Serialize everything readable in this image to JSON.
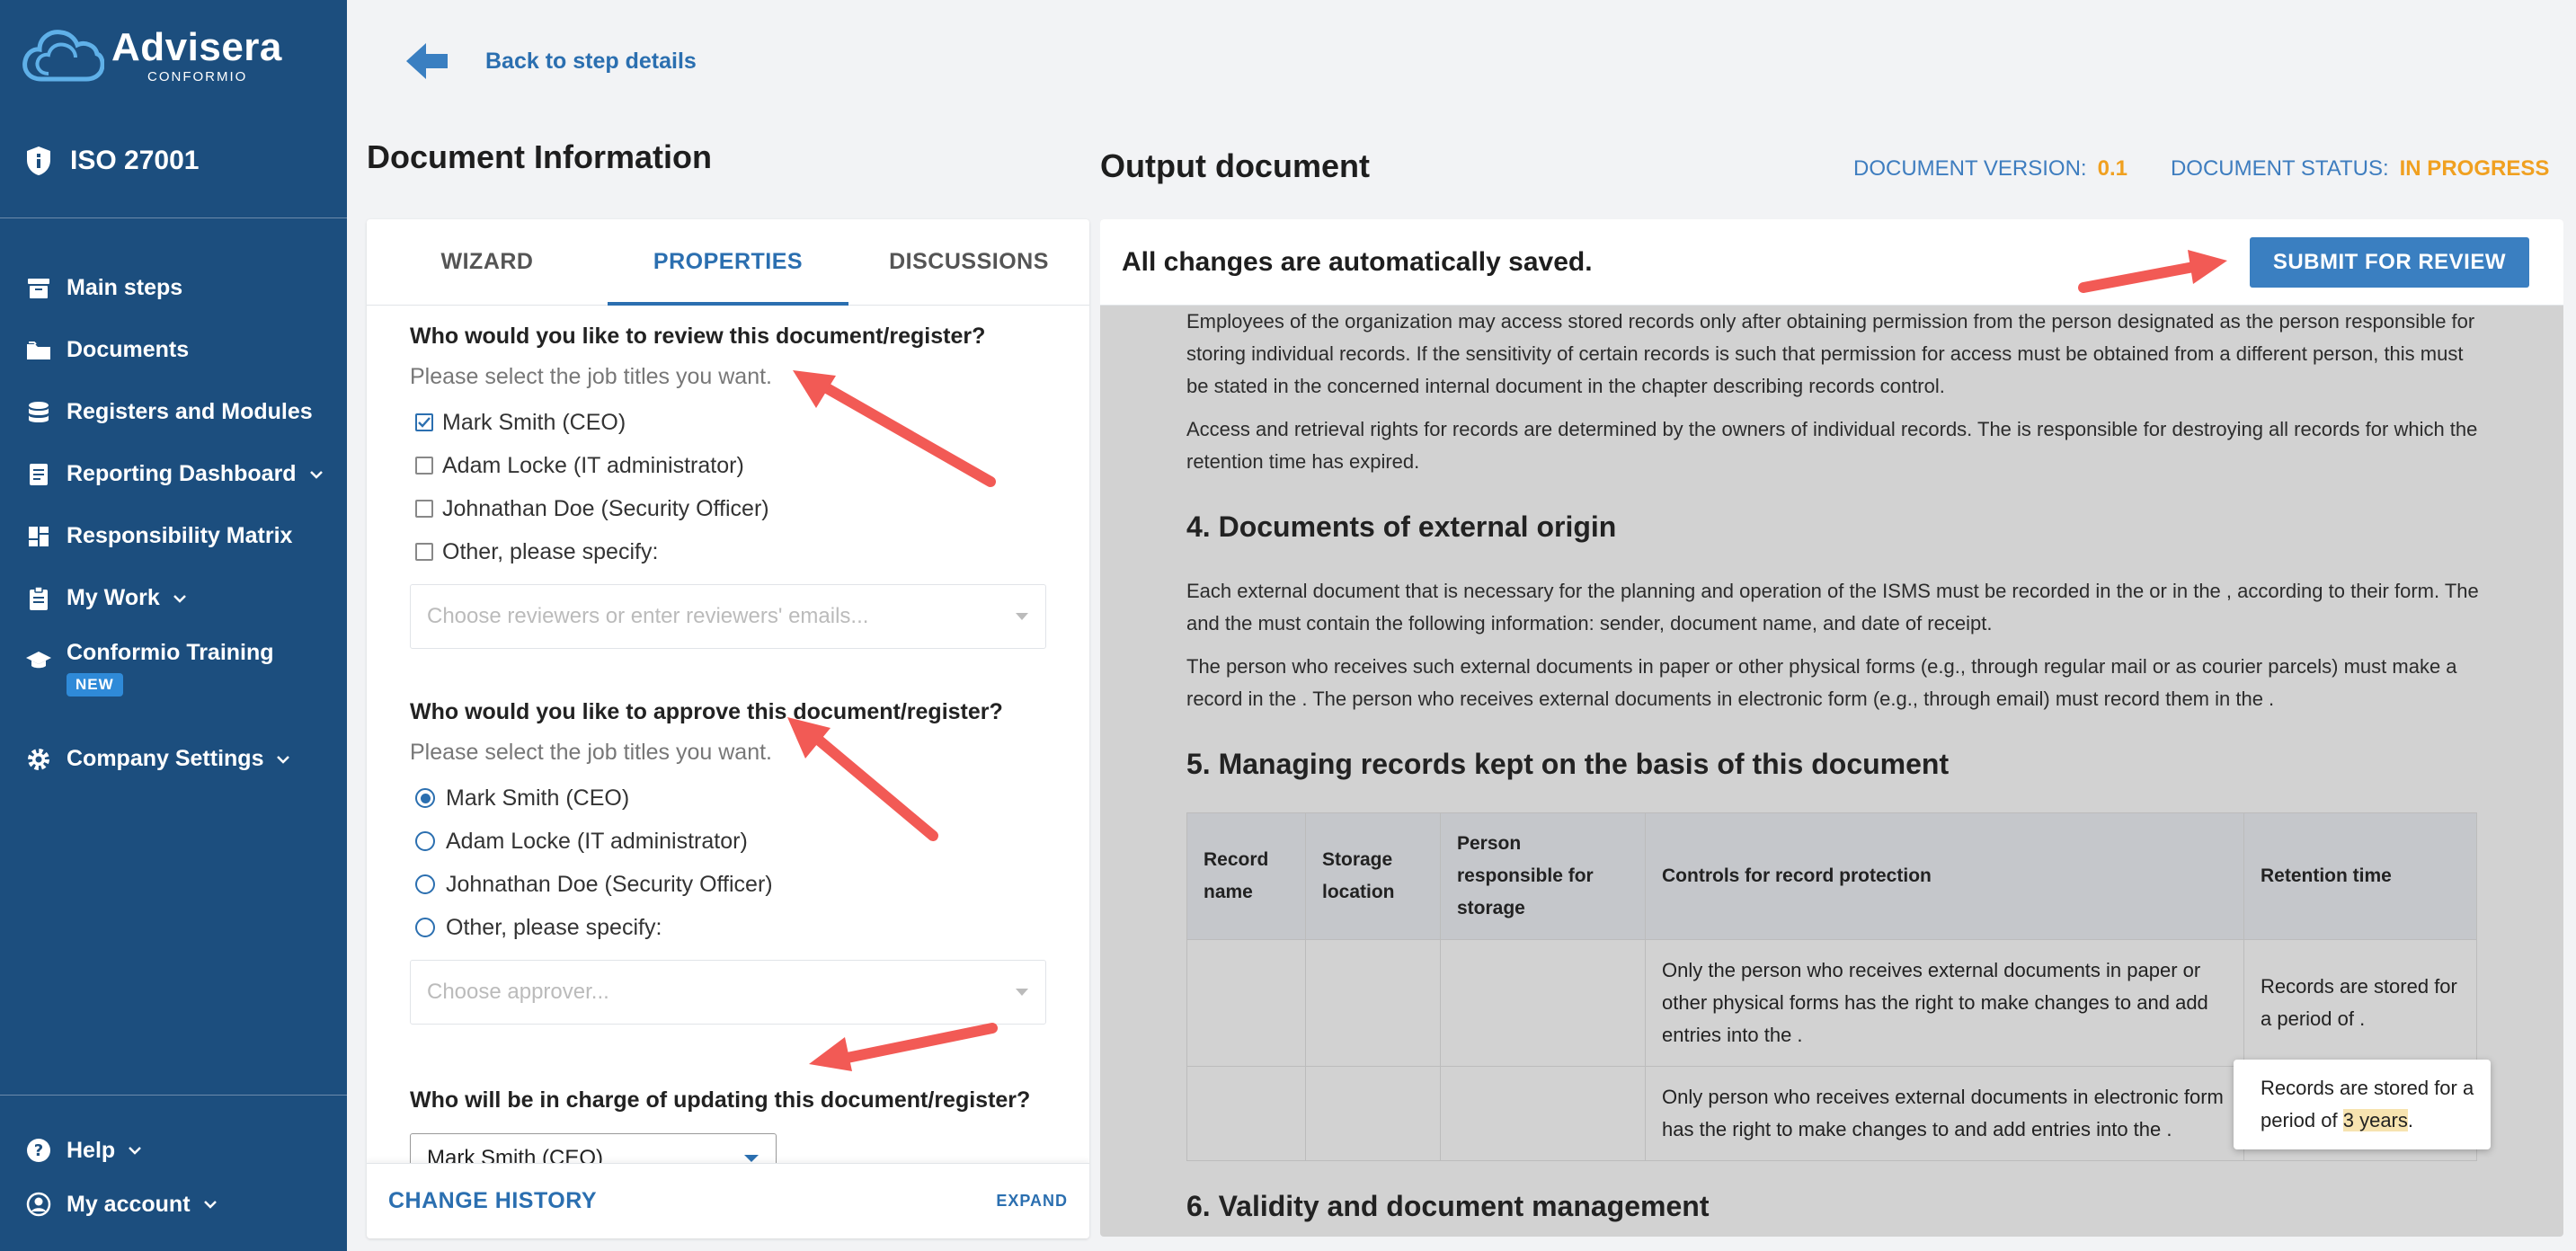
{
  "brand": {
    "name": "Advisera",
    "sub": "CONFORMIO"
  },
  "standard": "ISO 27001",
  "nav": [
    {
      "label": "Main steps",
      "icon": "box-icon"
    },
    {
      "label": "Documents",
      "icon": "folder-icon"
    },
    {
      "label": "Registers and Modules",
      "icon": "database-icon"
    },
    {
      "label": "Reporting Dashboard",
      "icon": "report-icon",
      "chevron": true
    },
    {
      "label": "Responsibility Matrix",
      "icon": "grid-icon"
    },
    {
      "label": "My Work",
      "icon": "clipboard-icon",
      "chevron": true
    }
  ],
  "training": {
    "label": "Conformio Training",
    "badge": "NEW"
  },
  "company_settings": "Company Settings",
  "help": "Help",
  "account": "My account",
  "back_label": "Back to step details",
  "doc_info_title": "Document Information",
  "output_title": "Output document",
  "doc_version_label": "DOCUMENT VERSION:",
  "doc_version": "0.1",
  "doc_status_label": "DOCUMENT STATUS:",
  "doc_status": "IN PROGRESS",
  "tabs": [
    "WIZARD",
    "PROPERTIES",
    "DISCUSSIONS"
  ],
  "review": {
    "question": "Who would you like to review this document/register?",
    "hint": "Please select the job titles you want.",
    "options": [
      "Mark Smith (CEO)",
      "Adam Locke (IT administrator)",
      "Johnathan Doe (Security Officer)",
      "Other, please specify:"
    ],
    "placeholder": "Choose reviewers or enter reviewers' emails..."
  },
  "approve": {
    "question": "Who would you like to approve this document/register?",
    "hint": "Please select the job titles you want.",
    "options": [
      "Mark Smith (CEO)",
      "Adam Locke (IT administrator)",
      "Johnathan Doe (Security Officer)",
      "Other, please specify:"
    ],
    "placeholder": "Choose approver..."
  },
  "update": {
    "question": "Who will be in charge of updating this document/register?",
    "value": "Mark Smith (CEO)"
  },
  "change_history": "CHANGE HISTORY",
  "expand": "EXPAND",
  "autosave": "All changes are automatically saved.",
  "submit": "SUBMIT FOR REVIEW",
  "doc": {
    "p1": "Employees of the organization may access stored records only after obtaining permission from the person designated as the person responsible for storing individual records. If the sensitivity of certain records is such that permission for access must be obtained from a different person, this must be stated in the concerned internal document in the chapter describing records control.",
    "p2": "Access and retrieval rights for records are determined by the owners of individual records. The is responsible for destroying all records for which the retention time has expired.",
    "h4": "4. Documents of external origin",
    "p3": "Each external document that is necessary for the planning and operation of the ISMS must be recorded in the or in the , according to their form. The and the must contain the following information: sender, document name, and date of receipt.",
    "p4": "The person who receives such external documents in paper or other physical forms (e.g., through regular mail or as courier parcels) must make a record in the . The person who receives external documents in electronic form (e.g., through email) must record them in the .",
    "h5": "5. Managing records kept on the basis of this document",
    "table_headers": [
      "Record name",
      "Storage location",
      "Person responsible for storage",
      "Controls for record protection",
      "Retention time"
    ],
    "row1_controls": "Only the person who receives external documents in paper or other physical forms has the right to make changes to and add entries into the .",
    "row1_retention": "Records are stored for a period of .",
    "row2_controls": "Only person who receives external documents in electronic form has the right to make changes to and add entries into the .",
    "row2_retention_a": "Records are stored for a period of ",
    "row2_retention_hl": "3 years",
    "row2_retention_b": ".",
    "h6": "6. Validity and document management"
  },
  "colors": {
    "sidebar": "#1c4e7e",
    "accent": "#2b6fb0",
    "status": "#f0a020",
    "annotation_arrow": "#f25a55"
  }
}
